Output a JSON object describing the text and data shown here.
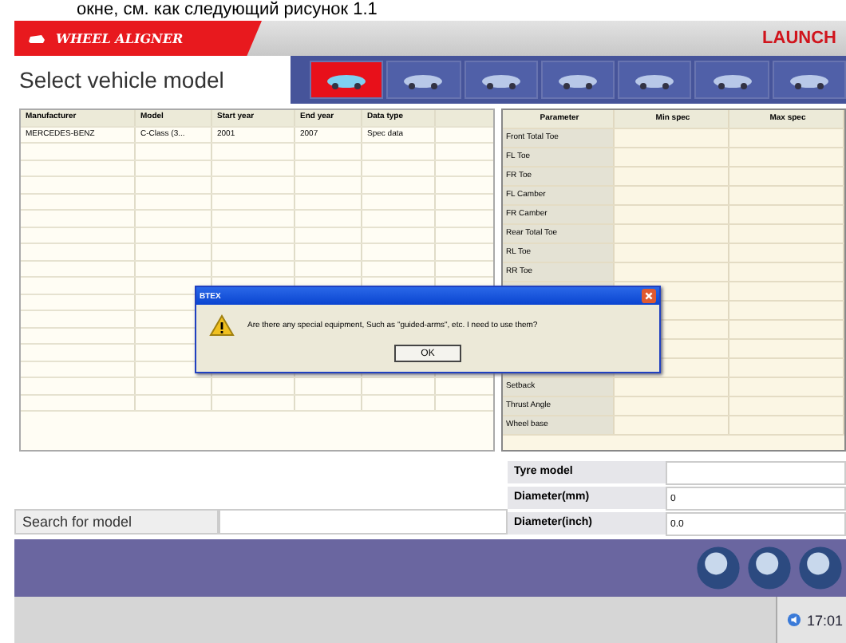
{
  "caption": "окне, см. как следующий рисунок 1.1",
  "header": {
    "title": "WHEEL ALIGNER",
    "brand": "LAUNCH"
  },
  "page_title": "Select vehicle model",
  "toolbar": [
    {
      "selected": true
    },
    {
      "selected": false
    },
    {
      "selected": false
    },
    {
      "selected": false
    },
    {
      "selected": false
    },
    {
      "selected": false
    },
    {
      "selected": false
    }
  ],
  "vehicle_table": {
    "columns": [
      "Manufacturer",
      "Model",
      "Start year",
      "End year",
      "Data type"
    ],
    "rows": [
      [
        "MERCEDES-BENZ",
        "C-Class (3...",
        "2001",
        "2007",
        "Spec data"
      ]
    ]
  },
  "spec_table": {
    "columns": [
      "Parameter",
      "Min spec",
      "Max spec"
    ],
    "rows_top": [
      "Front Total Toe",
      "FL Toe",
      "FR Toe",
      "FL Camber",
      "FR Camber",
      "Rear Total Toe",
      "RL Toe",
      "RR Toe"
    ],
    "rows_bottom": [
      "Setback",
      "Thrust Angle",
      "Wheel base"
    ]
  },
  "dialog": {
    "title": "BTEX",
    "message": "Are there any special equipment, Such as \"guided-arms\", etc. I need to use them?",
    "button": "OK"
  },
  "search": {
    "label": "Search for model"
  },
  "tyre": [
    {
      "label": "Tyre model"
    },
    {
      "label": "Diameter(mm)",
      "value": "0"
    },
    {
      "label": "Diameter(inch)",
      "value": "0.0"
    }
  ],
  "clock": "17:01"
}
